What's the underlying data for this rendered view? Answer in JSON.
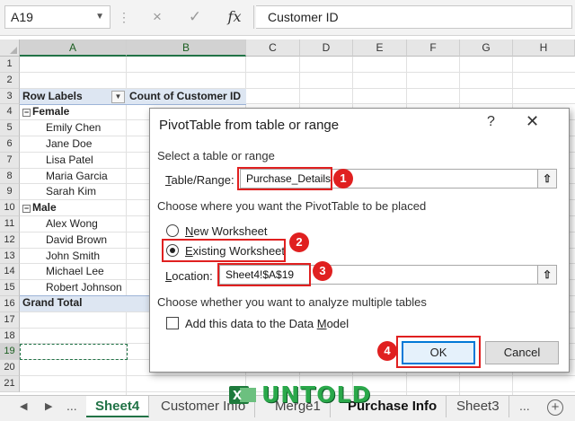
{
  "formula_bar": {
    "name_box": "A19",
    "formula": "Customer ID",
    "cancel_icon": "×",
    "enter_icon": "✓",
    "fx_icon": "fx"
  },
  "columns": [
    "A",
    "B",
    "C",
    "D",
    "E",
    "F",
    "G",
    "H"
  ],
  "rows": [
    "1",
    "2",
    "3",
    "4",
    "5",
    "6",
    "7",
    "8",
    "9",
    "10",
    "11",
    "12",
    "13",
    "14",
    "15",
    "16",
    "17",
    "18",
    "19",
    "20",
    "21"
  ],
  "pivot": {
    "row_labels_header": "Row Labels",
    "count_header": "Count of Customer ID",
    "groups": [
      {
        "label": "Female",
        "items": [
          "Emily Chen",
          "Jane Doe",
          "Lisa Patel",
          "Maria Garcia",
          "Sarah Kim"
        ]
      },
      {
        "label": "Male",
        "items": [
          "Alex Wong",
          "David Brown",
          "John Smith",
          "Michael Lee",
          "Robert Johnson"
        ]
      }
    ],
    "grand_total": "Grand Total"
  },
  "dialog": {
    "title": "PivotTable from table or range",
    "help": "?",
    "close": "✕",
    "section1": "Select a table or range",
    "table_range_label": "Table/Range:",
    "table_range_value": "Purchase_Details",
    "section2": "Choose where you want the PivotTable to be placed",
    "new_worksheet_label": "New Worksheet",
    "existing_worksheet_label": "Existing Worksheet",
    "location_label": "Location:",
    "location_value": "Sheet4!$A$19",
    "section3": "Choose whether you want to analyze multiple tables",
    "data_model_label": "Add this data to the Data Model",
    "ok_label": "OK",
    "cancel_label": "Cancel",
    "selected_option": "existing_worksheet"
  },
  "callouts": [
    "1",
    "2",
    "3",
    "4"
  ],
  "sheet_tabs": {
    "tabs": [
      "Sheet4",
      "Customer Info",
      "Merge1",
      "Purchase Info",
      "Sheet3"
    ],
    "active": "Sheet4",
    "nav_left": "◀",
    "nav_right": "▶",
    "more_left": "...",
    "more_right": "...",
    "add": "+"
  },
  "watermark": {
    "text": "UNTOLD"
  },
  "colors": {
    "accent": "#217346",
    "callout": "#e02020",
    "pivot_band": "#dde6f2",
    "ok_border": "#0078d7"
  }
}
